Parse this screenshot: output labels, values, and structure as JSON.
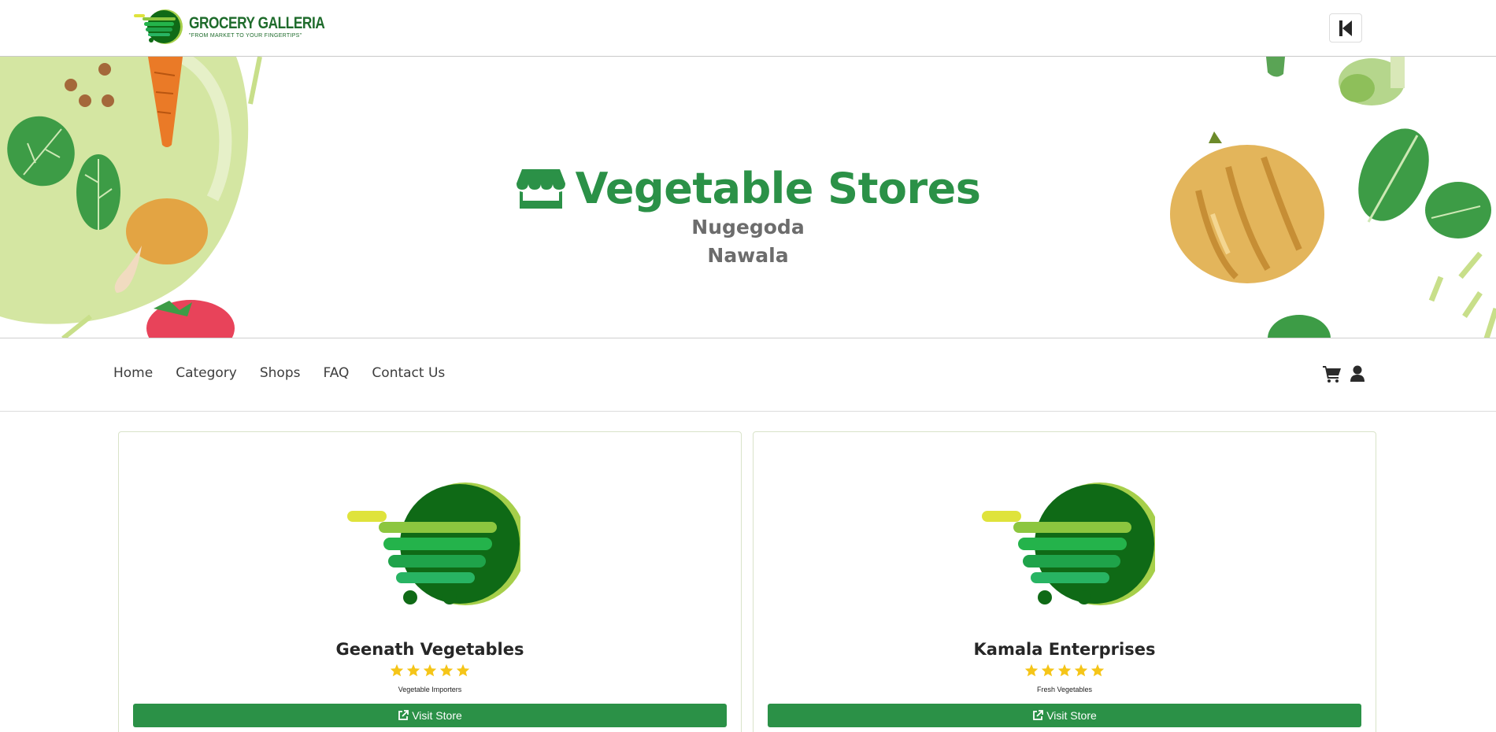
{
  "brand": {
    "name": "GROCERY GALLERIA",
    "tagline": "\"FROM MARKET TO YOUR FINGERTIPS\"",
    "primary_color": "#2b9147",
    "dark_green": "#1e6b2b"
  },
  "header": {
    "back_icon": "backward-step-icon"
  },
  "hero": {
    "icon": "store-icon",
    "title": "Vegetable Stores",
    "locations": [
      "Nugegoda",
      "Nawala"
    ]
  },
  "nav": {
    "links": [
      "Home",
      "Category",
      "Shops",
      "FAQ",
      "Contact Us"
    ],
    "icons": [
      "cart-icon",
      "user-icon"
    ]
  },
  "stores": [
    {
      "name": "Geenath Vegetables",
      "rating": 5,
      "description": "Vegetable Importers",
      "button_label": "Visit Store",
      "button_icon": "external-link-icon"
    },
    {
      "name": "Kamala Enterprises",
      "rating": 5,
      "description": "Fresh Vegetables",
      "button_label": "Visit Store",
      "button_icon": "external-link-icon"
    }
  ]
}
